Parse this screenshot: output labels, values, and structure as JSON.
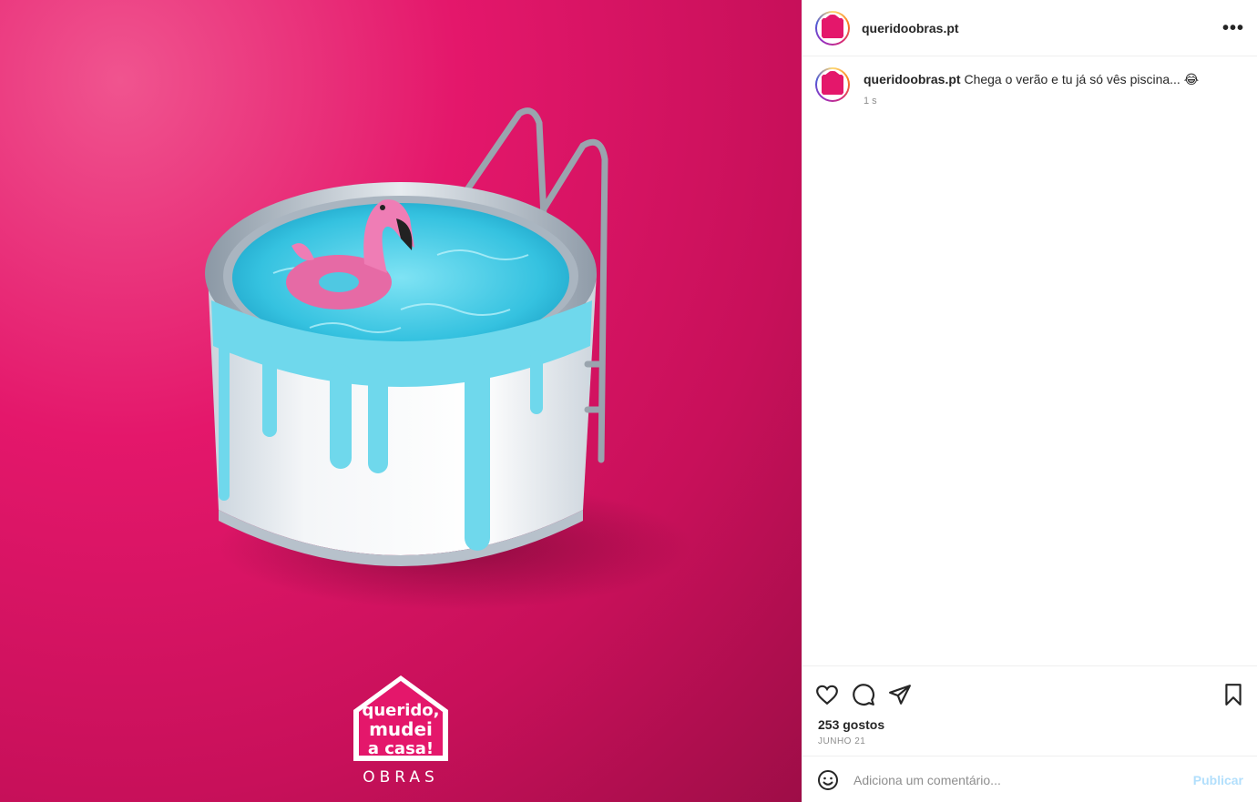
{
  "post": {
    "username": "queridoobras.pt",
    "caption_text": "Chega o verão e tu já só vês piscina... 😂",
    "caption_time": "1 s",
    "likes": "253 gostos",
    "date": "JUNHO 21"
  },
  "brand": {
    "logo_text": [
      "querido,",
      "mudei",
      "a casa!"
    ],
    "obras": "OBRAS"
  },
  "header": {
    "more_icon": "more-dots-icon"
  },
  "actions": {
    "icons": [
      "heart-icon",
      "comment-icon",
      "share-icon",
      "bookmark-icon"
    ]
  },
  "comment": {
    "placeholder": "Adiciona um comentário...",
    "publish_label": "Publicar",
    "emoji_icon": "emoji-icon"
  },
  "colors": {
    "background_pink": "#e4176b",
    "pool_blue": "#5fd3e8",
    "publish_disabled": "#b2dffc"
  }
}
